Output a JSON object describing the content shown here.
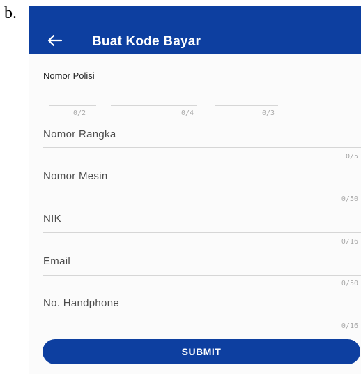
{
  "figure_label": "b.",
  "appbar": {
    "title": "Buat Kode Bayar",
    "back_icon": "arrow-left-icon",
    "color": "#0d3fa0"
  },
  "nomor_polisi": {
    "label": "Nomor Polisi",
    "segments": [
      {
        "counter": "0/2"
      },
      {
        "counter": "0/4"
      },
      {
        "counter": "0/3"
      }
    ]
  },
  "fields": [
    {
      "label": "Nomor Rangka",
      "counter": "0/5"
    },
    {
      "label": "Nomor Mesin",
      "counter": "0/50"
    },
    {
      "label": "NIK",
      "counter": "0/16"
    },
    {
      "label": "Email",
      "counter": "0/50"
    },
    {
      "label": "No. Handphone",
      "counter": "0/16"
    }
  ],
  "submit_label": "SUBMIT"
}
